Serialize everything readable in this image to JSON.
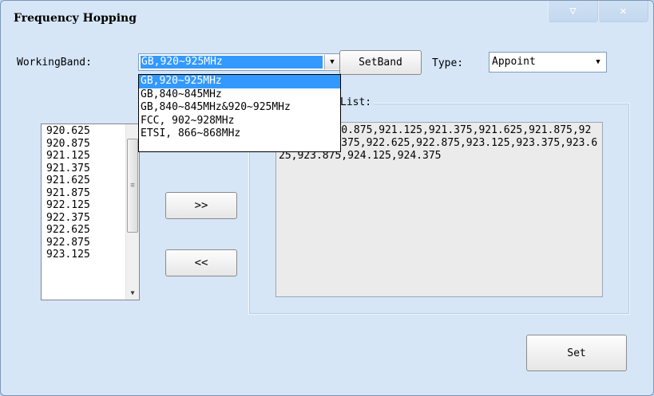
{
  "window": {
    "title": "Frequency Hopping",
    "minimize_glyph": "▽",
    "close_glyph": "✕"
  },
  "working_band": {
    "label": "WorkingBand:",
    "value": "GB,920~925MHz",
    "options": [
      "GB,920~925MHz",
      "GB,840~845MHz",
      "GB,840~845MHz&920~925MHz",
      "FCC, 902~928MHz",
      "ETSI, 866~868MHz"
    ]
  },
  "set_band_button": "SetBand",
  "type": {
    "label": "Type:",
    "value": "Appoint"
  },
  "freq_list_label": "List:",
  "available_freqs": [
    "920.625",
    "920.875",
    "921.125",
    "921.375",
    "921.625",
    "921.875",
    "922.125",
    "922.375",
    "922.625",
    "922.875",
    "923.125"
  ],
  "add_button": ">>",
  "remove_button": "<<",
  "selected_freqs_text": "920.625,920.875,921.125,921.375,921.625,921.875,922.125,922.375,922.625,922.875,923.125,923.375,923.625,923.875,924.125,924.375",
  "set_button": "Set",
  "icons": {
    "combo_arrow": "▼",
    "scroll_grip": "≡",
    "scroll_down": "▼"
  }
}
